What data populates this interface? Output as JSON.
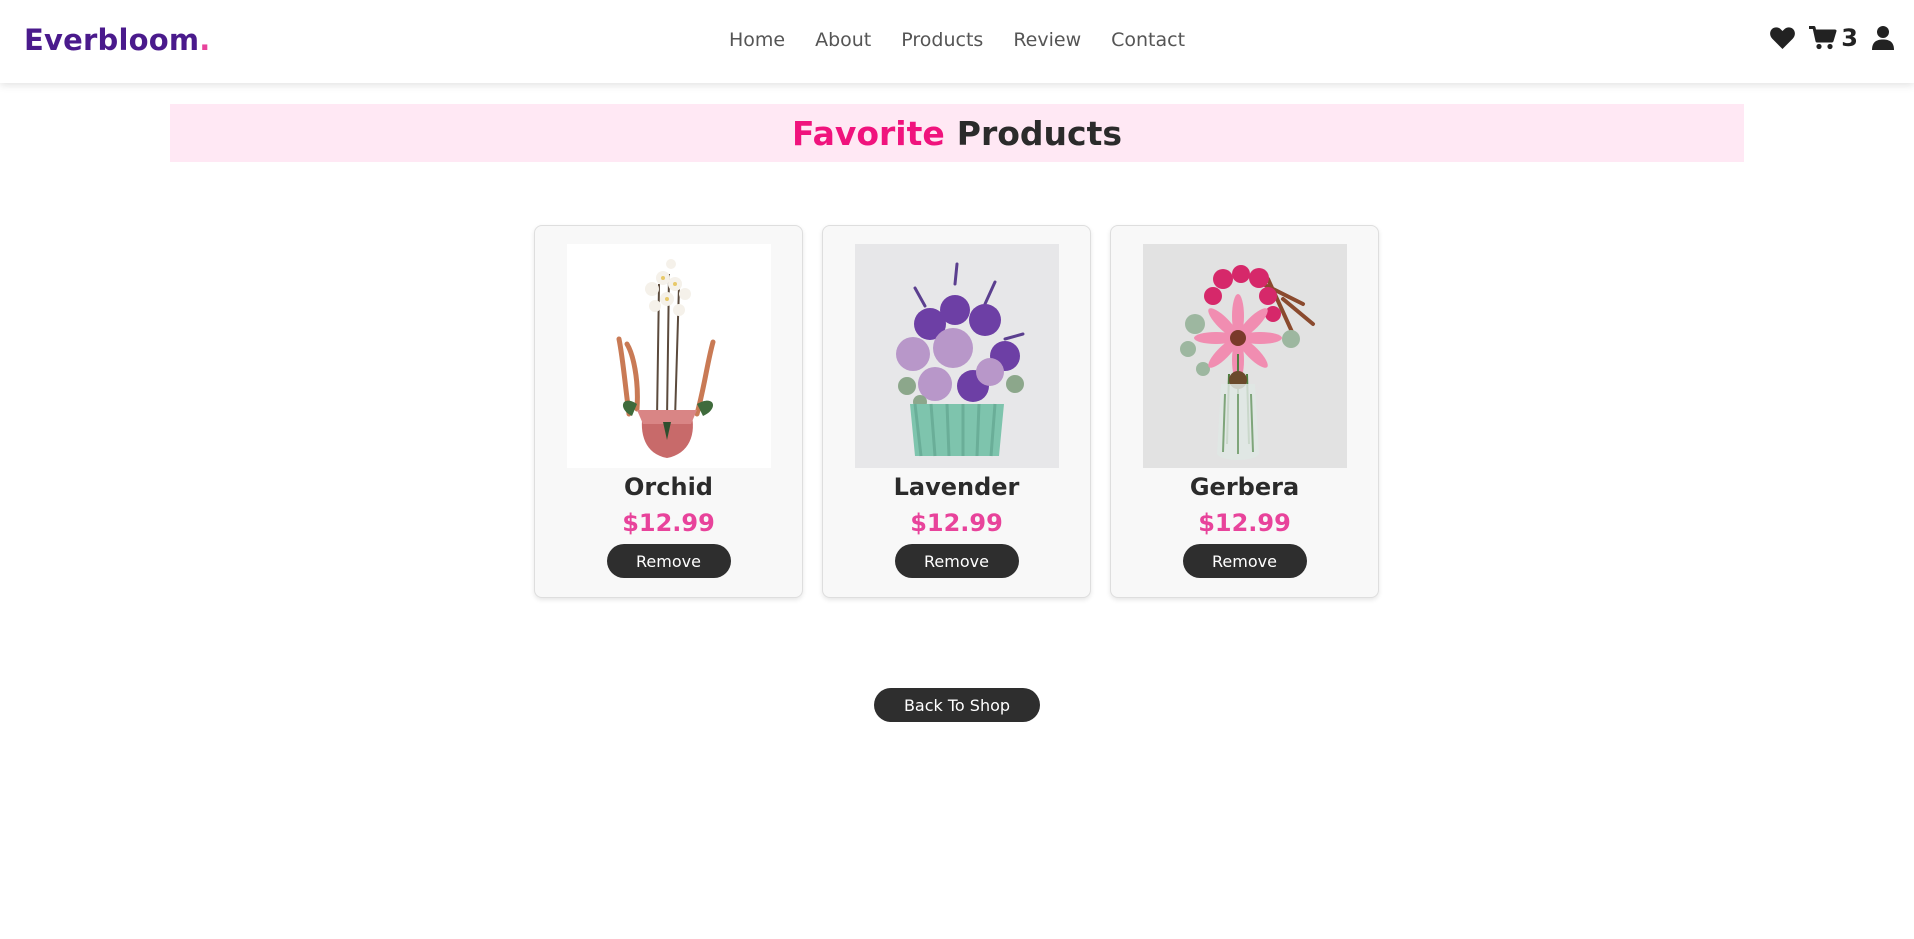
{
  "header": {
    "logo_text": "Everbloom",
    "logo_dot": ".",
    "nav": [
      {
        "label": "Home"
      },
      {
        "label": "About"
      },
      {
        "label": "Products"
      },
      {
        "label": "Review"
      },
      {
        "label": "Contact"
      }
    ],
    "icons": {
      "favorites": "heart-icon",
      "cart": "cart-icon",
      "account": "user-icon"
    },
    "cart_count": "3"
  },
  "banner": {
    "highlight": "Favorite",
    "rest": "Products"
  },
  "products": [
    {
      "name": "Orchid",
      "price": "$12.99",
      "remove_label": "Remove"
    },
    {
      "name": "Lavender",
      "price": "$12.99",
      "remove_label": "Remove"
    },
    {
      "name": "Gerbera",
      "price": "$12.99",
      "remove_label": "Remove"
    }
  ],
  "back_button": "Back To Shop",
  "colors": {
    "brand": "#4a1a8c",
    "accent": "#e8439b",
    "banner_bg": "#ffe8f4",
    "banner_highlight": "#f0137d",
    "button_bg": "#2e2e2e"
  }
}
